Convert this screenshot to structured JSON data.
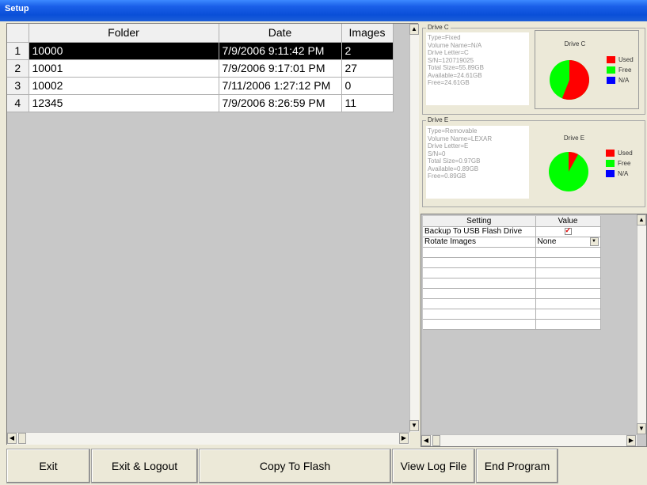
{
  "window": {
    "title": "Setup"
  },
  "folders": {
    "columns": [
      "Folder",
      "Date",
      "Images"
    ],
    "rows": [
      {
        "num": "1",
        "folder": "10000",
        "date": "7/9/2006 9:11:42 PM",
        "images": "2"
      },
      {
        "num": "2",
        "folder": "10001",
        "date": "7/9/2006 9:17:01 PM",
        "images": "27"
      },
      {
        "num": "3",
        "folder": "10002",
        "date": "7/11/2006 1:27:12 PM",
        "images": "0"
      },
      {
        "num": "4",
        "folder": "12345",
        "date": "7/9/2006 8:26:59 PM",
        "images": "11"
      }
    ]
  },
  "drive_c": {
    "group_label": "Drive C",
    "info": [
      "Type=Fixed",
      "Volume Name=N/A",
      "Drive Letter=C",
      "S/N=120719025",
      "Total Size=55.89GB",
      "Available=24.61GB",
      "Free=24.61GB"
    ],
    "chart_title": "Drive C",
    "used_fraction": 0.56
  },
  "drive_e": {
    "group_label": "Drive E",
    "info": [
      "Type=Removable",
      "Volume Name=LEXAR",
      "Drive Letter=E",
      "S/N=0",
      "Total Size=0.97GB",
      "Available=0.89GB",
      "Free=0.89GB"
    ],
    "chart_title": "Drive E",
    "used_fraction": 0.08
  },
  "legend": {
    "used": "Used",
    "free": "Free",
    "na": "N/A",
    "used_color": "#ff0000",
    "free_color": "#00ff00",
    "na_color": "#0000ff"
  },
  "settings": {
    "columns": [
      "Setting",
      "Value"
    ],
    "backup_label": "Backup To USB Flash Drive",
    "rotate_label": "Rotate Images",
    "rotate_value": "None"
  },
  "buttons": {
    "exit": "Exit",
    "exit_logout": "Exit & Logout",
    "copy_flash": "Copy To Flash",
    "view_log": "View Log File",
    "end_program": "End Program"
  }
}
